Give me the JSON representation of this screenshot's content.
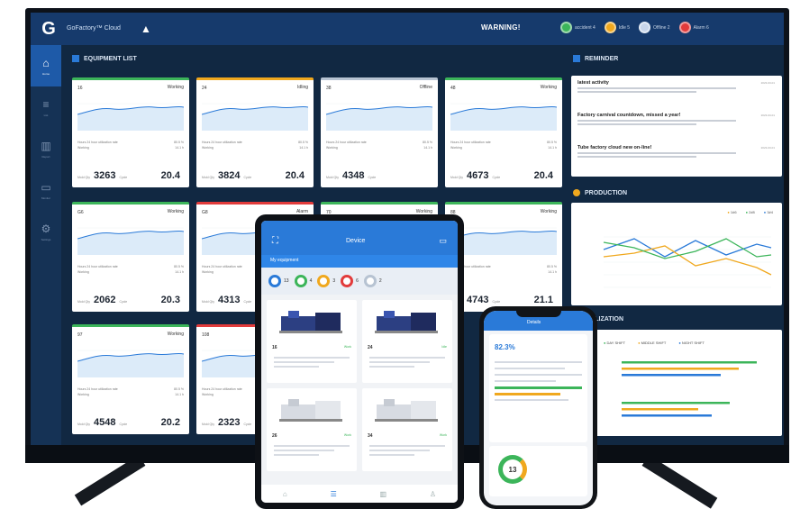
{
  "app": {
    "brand": "GoFactory™ Cloud",
    "logo_letter": "G",
    "warning": "WARNING!",
    "statuses": [
      {
        "label": "accident 4",
        "color": "#3cb55a"
      },
      {
        "label": "Idle 5",
        "color": "#f0a81e"
      },
      {
        "label": "Offline 2",
        "color": "#c9d6ea"
      },
      {
        "label": "Alarm 6",
        "color": "#e23b3b"
      }
    ]
  },
  "nav": [
    {
      "label": "Home",
      "icon": "home-icon"
    },
    {
      "label": "List",
      "icon": "list-icon"
    },
    {
      "label": "Report",
      "icon": "chart-icon"
    },
    {
      "label": "Monitor",
      "icon": "monitor-icon"
    },
    {
      "label": "Settings",
      "icon": "gear-icon"
    }
  ],
  "sections": {
    "equipment": "EQUIPMENT LIST",
    "reminder": "REMINDER",
    "production": "PRODUCTION",
    "utilization": "UTILIZATION"
  },
  "equipment": [
    {
      "id": "16",
      "state": "Working",
      "state_color": "#3cb55a",
      "value": "3263",
      "rate": "20.4"
    },
    {
      "id": "24",
      "state": "Idling",
      "state_color": "#f0a81e",
      "value": "3824",
      "rate": "20.4"
    },
    {
      "id": "38",
      "state": "Offline",
      "state_color": "#b7c3d2",
      "value": "4348",
      "rate": ""
    },
    {
      "id": "48",
      "state": "Working",
      "state_color": "#3cb55a",
      "value": "4673",
      "rate": "20.4"
    },
    {
      "id": "G6",
      "state": "Working",
      "state_color": "#3cb55a",
      "value": "2062",
      "rate": "20.3"
    },
    {
      "id": "G8",
      "state": "Alarm",
      "state_color": "#e23b3b",
      "value": "4313",
      "rate": ""
    },
    {
      "id": "70",
      "state": "Working",
      "state_color": "#3cb55a",
      "value": "",
      "rate": ""
    },
    {
      "id": "88",
      "state": "Working",
      "state_color": "#3cb55a",
      "value": "4743",
      "rate": "21.1"
    },
    {
      "id": "97",
      "state": "Working",
      "state_color": "#3cb55a",
      "value": "4548",
      "rate": "20.2"
    },
    {
      "id": "108",
      "state": "Alarm",
      "state_color": "#e23b3b",
      "value": "2323",
      "rate": ""
    }
  ],
  "equipment_row_labels": {
    "util": "Hours 24 hour utilization rate",
    "working": "Working",
    "util_value": "80.5 %",
    "working_value": "14.1 h",
    "count_label": "Mold Qty",
    "cycle_label": "Cycle",
    "unit": "s"
  },
  "reminders": [
    {
      "title": "latest activity",
      "date": "2023-03-01"
    },
    {
      "title": "Factory carnival countdown, missed a year!",
      "date": "2023-03-01"
    },
    {
      "title": "Tube factory cloud new on-line!",
      "date": "2023-03-01"
    }
  ],
  "production_legend": [
    "1#6",
    "2#8",
    "3#4"
  ],
  "utilization_legend": [
    "DAY SHIFT",
    "MIDDLE SHIFT",
    "NIGHT SHIFT"
  ],
  "tablet": {
    "title": "Device",
    "tab": "My equipment",
    "summary": [
      {
        "count": "13",
        "color": "#2a7ad8"
      },
      {
        "count": "4",
        "color": "#3cb55a"
      },
      {
        "count": "3",
        "color": "#f0a81e"
      },
      {
        "count": "6",
        "color": "#e23b3b"
      },
      {
        "count": "2",
        "color": "#b7c3d2"
      }
    ],
    "cards": [
      {
        "id": "16",
        "state": "Work"
      },
      {
        "id": "24",
        "state": "Idle"
      },
      {
        "id": "26",
        "state": "Work"
      },
      {
        "id": "34",
        "state": "Work"
      }
    ]
  },
  "phone": {
    "title": "Details",
    "gauge": "13",
    "percent": "82.3%"
  }
}
